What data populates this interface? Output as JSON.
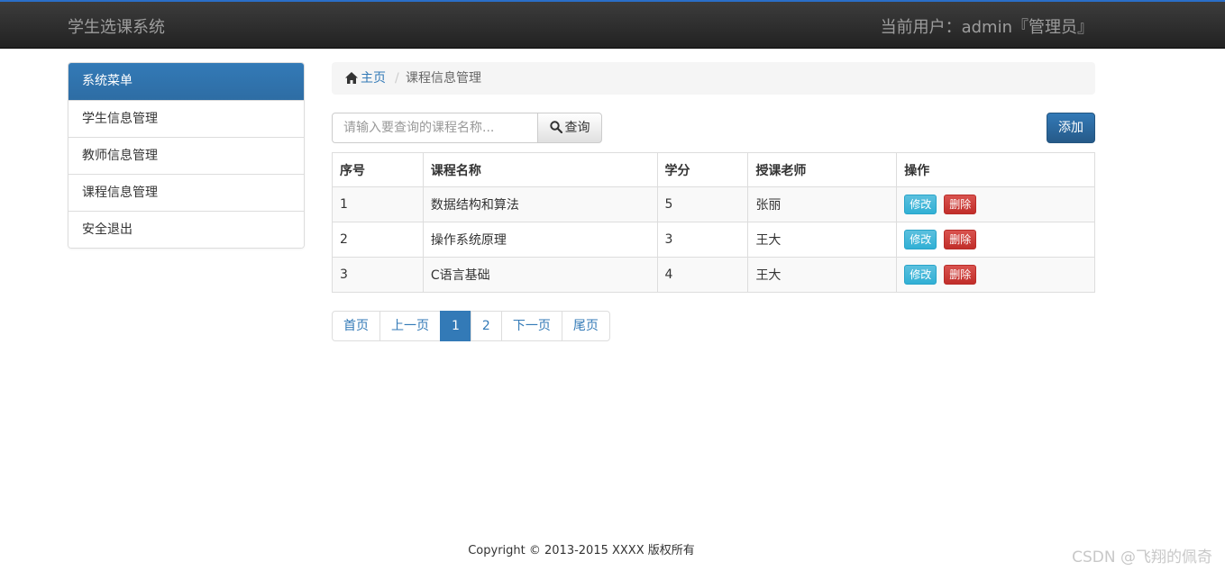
{
  "navbar": {
    "brand": "学生选课系统",
    "current_user": "当前用户：admin『管理员』",
    "accent_color": "#2a6fc9"
  },
  "sidebar": {
    "header": "系统菜单",
    "items": [
      {
        "label": "学生信息管理"
      },
      {
        "label": "教师信息管理"
      },
      {
        "label": "课程信息管理"
      },
      {
        "label": "安全退出"
      }
    ]
  },
  "breadcrumb": {
    "home_icon": "home-icon",
    "home": "主页",
    "separator": "/",
    "current": "课程信息管理"
  },
  "toolbar": {
    "search_placeholder": "请输入要查询的课程名称...",
    "search_icon": "search-icon",
    "query_label": "查询",
    "add_label": "添加",
    "primary_color": "#337ab7"
  },
  "table": {
    "headers": [
      "序号",
      "课程名称",
      "学分",
      "授课老师",
      "操作"
    ],
    "rows": [
      {
        "id": "1",
        "name": "数据结构和算法",
        "credit": "5",
        "teacher": "张丽",
        "edit": "修改",
        "delete": "删除"
      },
      {
        "id": "2",
        "name": "操作系统原理",
        "credit": "3",
        "teacher": "王大",
        "edit": "修改",
        "delete": "删除"
      },
      {
        "id": "3",
        "name": "C语言基础",
        "credit": "4",
        "teacher": "王大",
        "edit": "修改",
        "delete": "删除"
      }
    ]
  },
  "pagination": {
    "first": "首页",
    "prev": "上一页",
    "pages": [
      "1",
      "2"
    ],
    "current_page": "1",
    "next": "下一页",
    "last": "尾页"
  },
  "footer": {
    "copyright": "Copyright © 2013-2015 XXXX 版权所有"
  },
  "watermark": "CSDN @飞翔的佩奇"
}
